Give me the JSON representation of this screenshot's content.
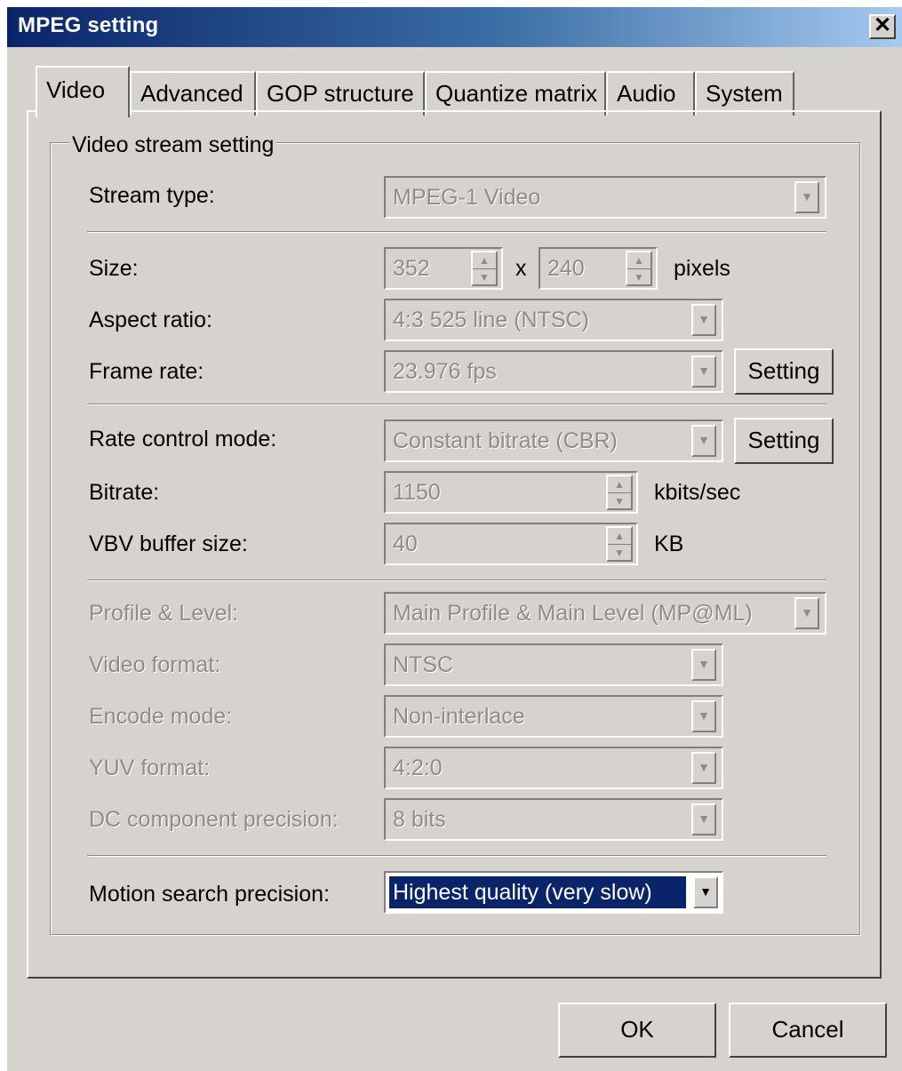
{
  "window": {
    "title": "MPEG setting",
    "close_symbol": "✕"
  },
  "tabs": [
    {
      "label": "Video",
      "active": true
    },
    {
      "label": "Advanced",
      "active": false
    },
    {
      "label": "GOP structure",
      "active": false
    },
    {
      "label": "Quantize matrix",
      "active": false
    },
    {
      "label": "Audio",
      "active": false
    },
    {
      "label": "System",
      "active": false
    }
  ],
  "group": {
    "title": "Video stream setting"
  },
  "fields": {
    "stream_type": {
      "label": "Stream type:",
      "value": "MPEG-1 Video"
    },
    "size": {
      "label": "Size:",
      "width": "352",
      "height": "240",
      "separator": "x",
      "unit": "pixels"
    },
    "aspect_ratio": {
      "label": "Aspect ratio:",
      "value": "4:3 525 line (NTSC)"
    },
    "frame_rate": {
      "label": "Frame rate:",
      "value": "23.976 fps",
      "button": "Setting"
    },
    "rate_control": {
      "label": "Rate control mode:",
      "value": "Constant bitrate (CBR)",
      "button": "Setting"
    },
    "bitrate": {
      "label": "Bitrate:",
      "value": "1150",
      "unit": "kbits/sec"
    },
    "vbv": {
      "label": "VBV buffer size:",
      "value": "40",
      "unit": "KB"
    },
    "profile_level": {
      "label": "Profile & Level:",
      "value": "Main Profile & Main Level (MP@ML)"
    },
    "video_format": {
      "label": "Video format:",
      "value": "NTSC"
    },
    "encode_mode": {
      "label": "Encode mode:",
      "value": "Non-interlace"
    },
    "yuv_format": {
      "label": "YUV format:",
      "value": "4:2:0"
    },
    "dc_precision": {
      "label": "DC component precision:",
      "value": "8 bits"
    },
    "motion_search": {
      "label": "Motion search precision:",
      "value": "Highest quality (very slow)"
    }
  },
  "icons": {
    "dropdown": "▼",
    "spin_up": "▲",
    "spin_down": "▼"
  },
  "buttons": {
    "ok": "OK",
    "cancel": "Cancel"
  }
}
